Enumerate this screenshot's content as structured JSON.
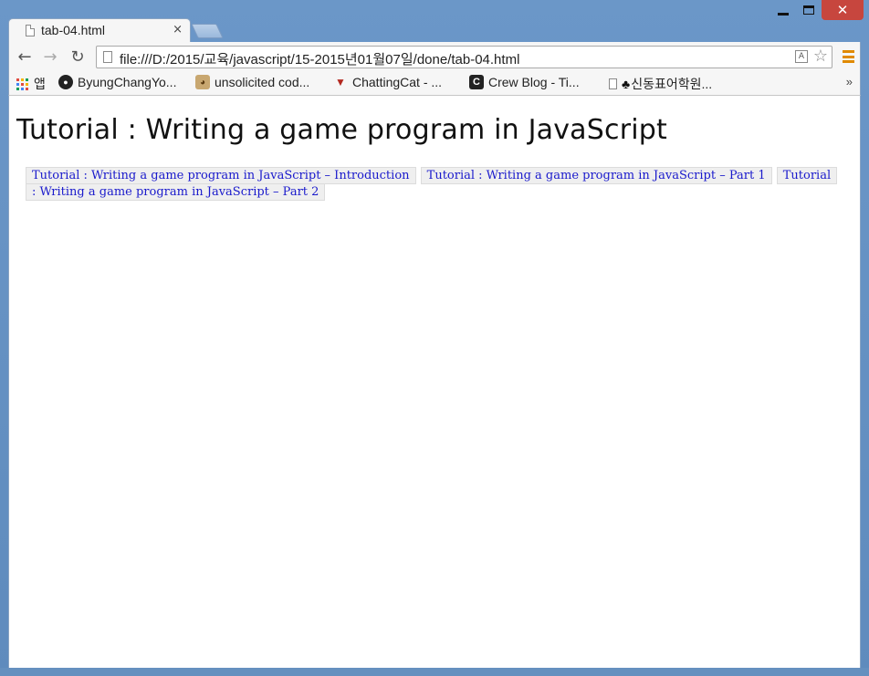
{
  "browser": {
    "tab_title": "tab-04.html",
    "tab_close": "×",
    "url": "file:///D:/2015/교육/javascript/15-2015년01월07일/done/tab-04.html",
    "window_close": "✕"
  },
  "nav": {
    "back": "←",
    "forward": "→",
    "reload": "↻",
    "star": "☆",
    "translate": "A"
  },
  "bookmarks": {
    "items": [
      {
        "label": "앱",
        "icon": "apps-grid-icon"
      },
      {
        "label": "ByungChangYo...",
        "icon": "github-icon"
      },
      {
        "label": "unsolicited cod...",
        "icon": "dog-icon"
      },
      {
        "label": "ChattingCat - ...",
        "icon": "cat-icon"
      },
      {
        "label": "Crew Blog - Ti...",
        "icon": "crew-icon"
      },
      {
        "label": "신동표어학원...",
        "icon": "page-icon"
      }
    ],
    "more": "»"
  },
  "page": {
    "title": "Tutorial : Writing a game program in JavaScript",
    "tabs": [
      "Tutorial : Writing a game program in JavaScript – Introduction",
      "Tutorial : Writing a game program in JavaScript – Part 1",
      "Tutorial : Writing a game program in JavaScript – Part 2"
    ]
  },
  "colors": {
    "frame": "#6590bf",
    "close_button": "#c7463e",
    "link": "#1a1acc",
    "tab_bg": "#efefef",
    "menu_icon": "#e08a00"
  }
}
